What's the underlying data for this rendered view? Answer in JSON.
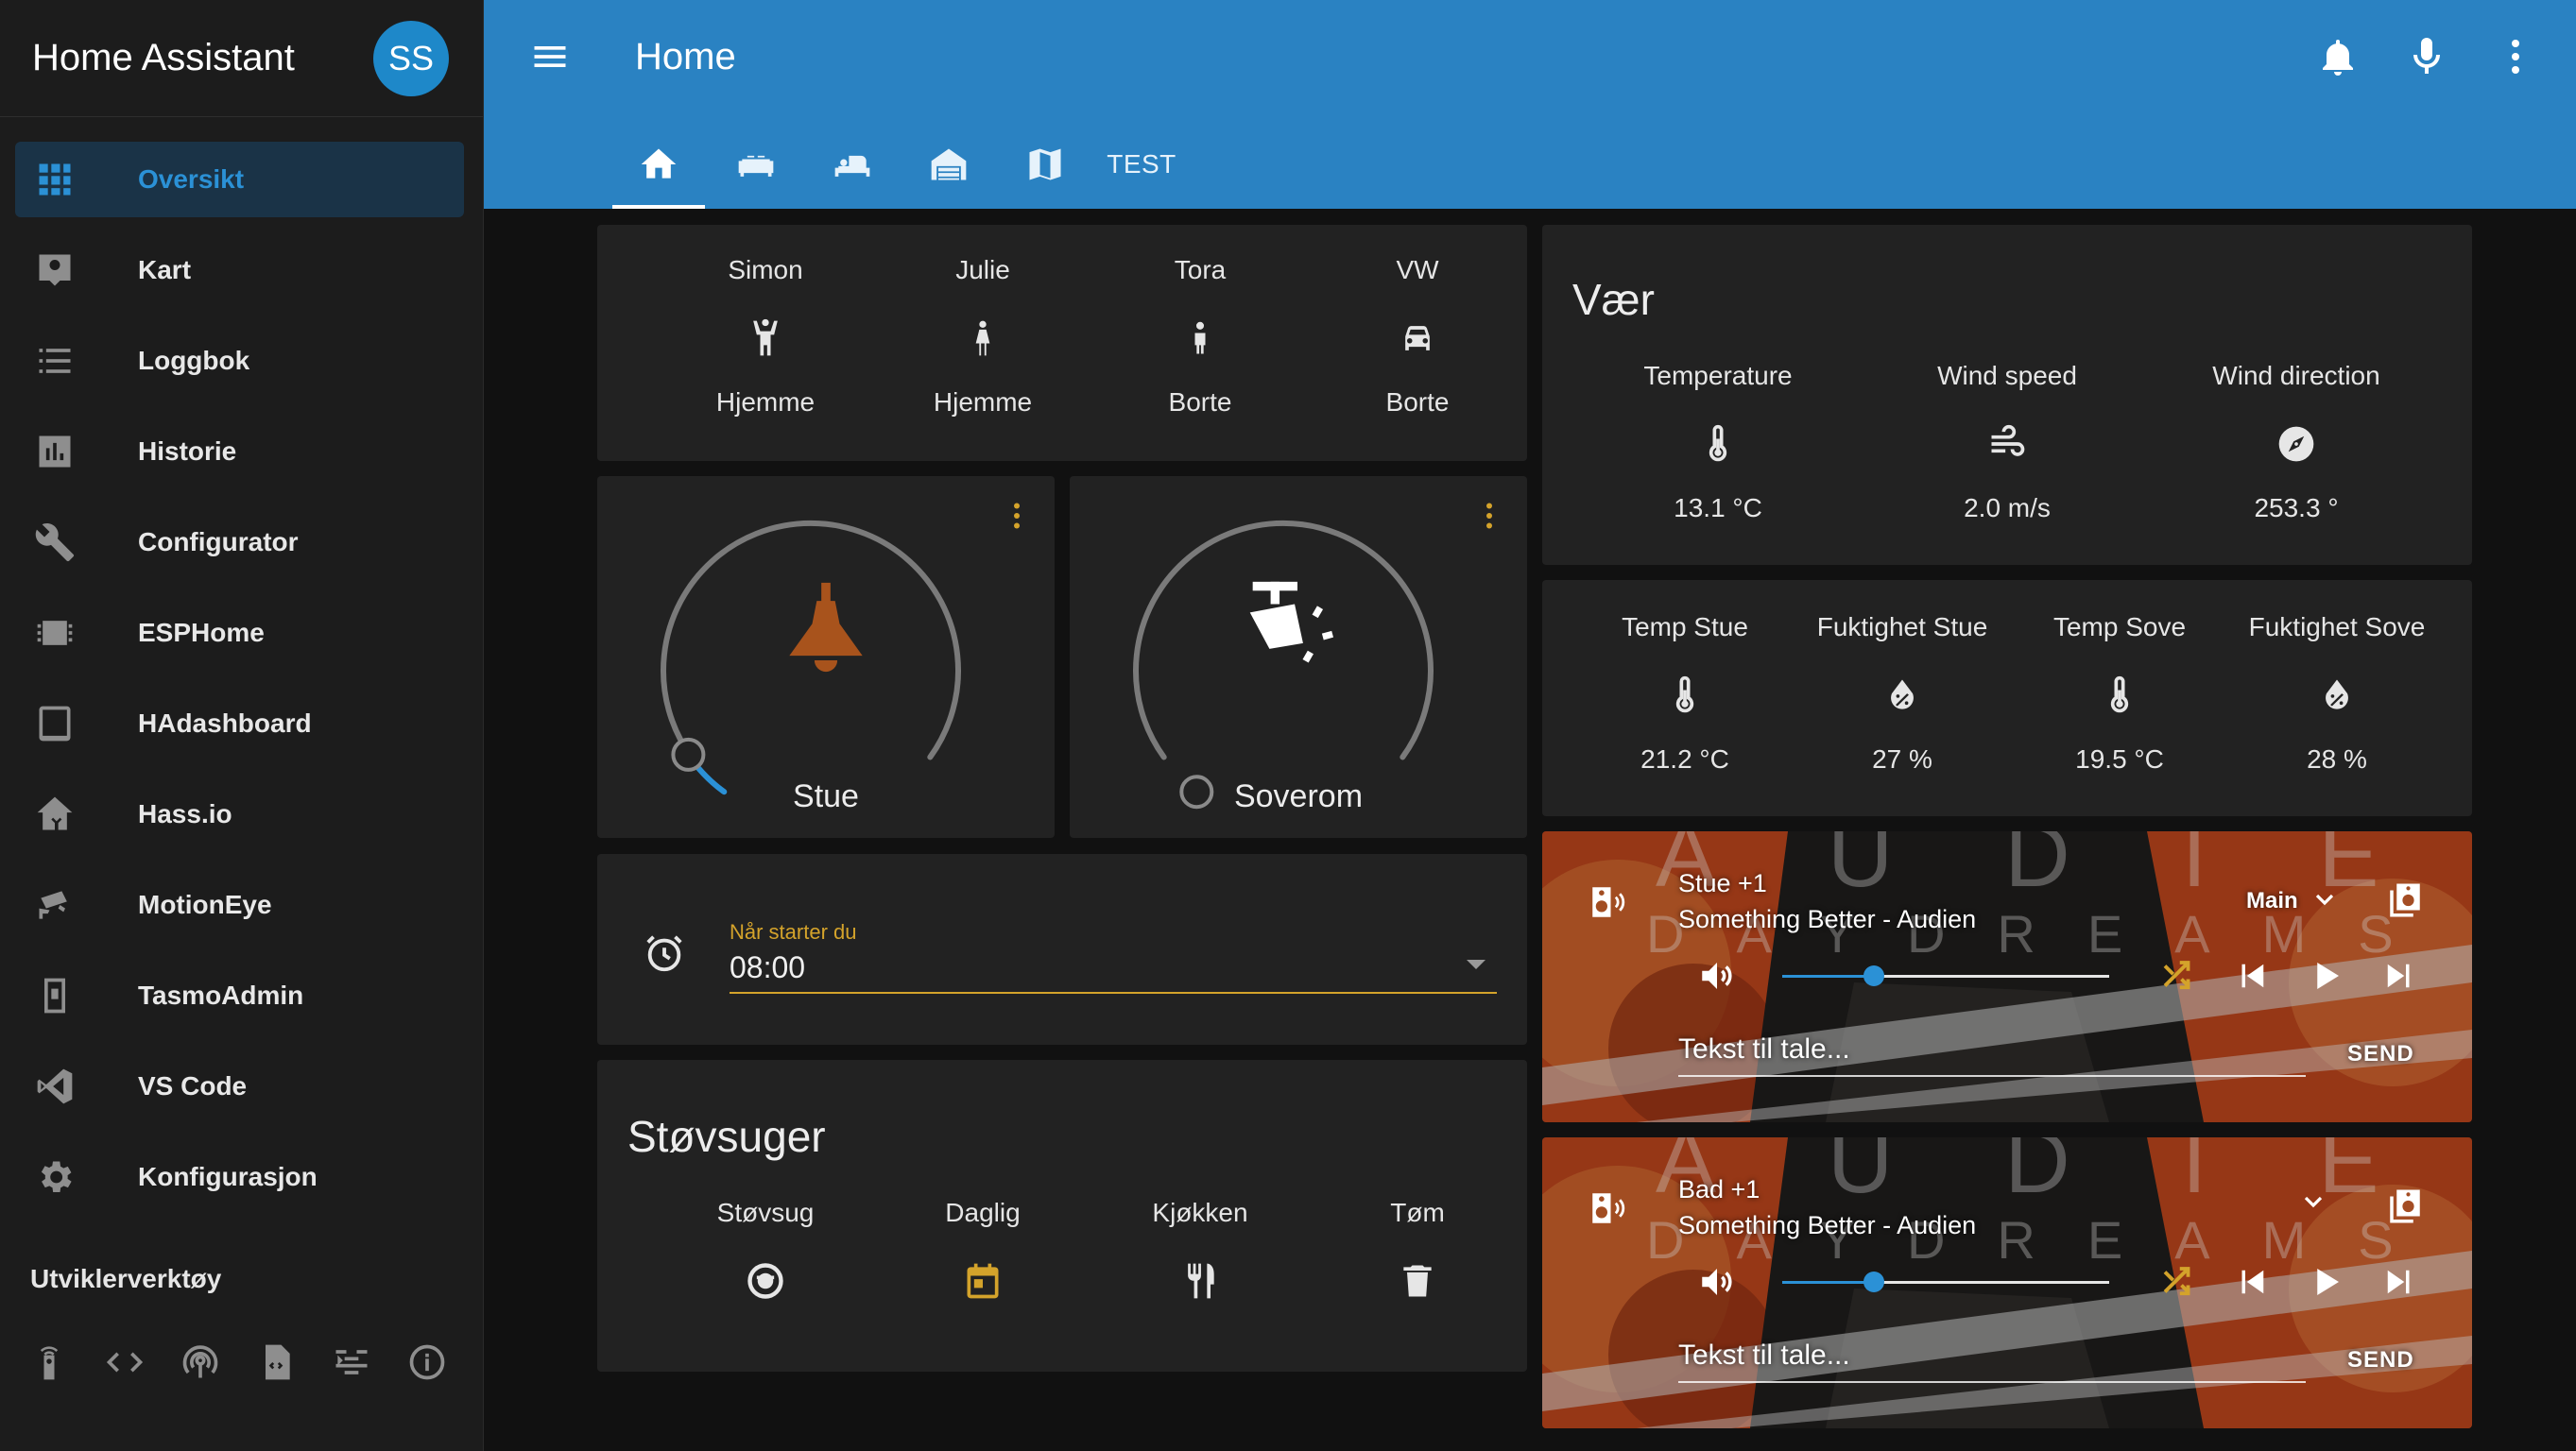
{
  "app": {
    "title": "Home Assistant",
    "avatar_initials": "SS",
    "accent": "#2a82c2",
    "gold": "#d4a32b"
  },
  "sidebar": {
    "items": [
      {
        "label": "Oversikt",
        "icon": "grid-icon",
        "active": true
      },
      {
        "label": "Kart",
        "icon": "account-box-icon"
      },
      {
        "label": "Loggbok",
        "icon": "list-icon"
      },
      {
        "label": "Historie",
        "icon": "chart-icon"
      },
      {
        "label": "Configurator",
        "icon": "wrench-icon"
      },
      {
        "label": "ESPHome",
        "icon": "chip-icon"
      },
      {
        "label": "HAdashboard",
        "icon": "tablet-icon"
      },
      {
        "label": "Hass.io",
        "icon": "home-assistant-icon"
      },
      {
        "label": "MotionEye",
        "icon": "cctv-icon"
      },
      {
        "label": "TasmoAdmin",
        "icon": "device-icon"
      },
      {
        "label": "VS Code",
        "icon": "vscode-icon"
      },
      {
        "label": "Konfigurasjon",
        "icon": "gear-icon"
      }
    ],
    "developer_title": "Utviklerverktøy",
    "developer_tools": [
      "remote-icon",
      "code-icon",
      "broadcast-icon",
      "file-code-icon",
      "template-icon",
      "info-icon"
    ]
  },
  "header": {
    "title": "Home",
    "tabs": [
      {
        "icon": "home-icon",
        "active": true
      },
      {
        "icon": "sofa-icon"
      },
      {
        "icon": "bed-icon"
      },
      {
        "icon": "garage-icon"
      },
      {
        "icon": "map-icon"
      },
      {
        "label": "TEST"
      }
    ],
    "actions": [
      "bell-icon",
      "microphone-icon",
      "more-vertical-icon"
    ]
  },
  "people": [
    {
      "name": "Simon",
      "state": "Hjemme",
      "icon": "person-arms-up-icon"
    },
    {
      "name": "Julie",
      "state": "Hjemme",
      "icon": "woman-icon"
    },
    {
      "name": "Tora",
      "state": "Borte",
      "icon": "child-icon"
    },
    {
      "name": "VW",
      "state": "Borte",
      "icon": "car-icon"
    }
  ],
  "thermostats": [
    {
      "name": "Stue",
      "icon": "lamp-icon",
      "level": 0.07
    },
    {
      "name": "Soverom",
      "icon": "shower-icon",
      "level": 0.0
    }
  ],
  "alarm": {
    "label": "Når starter du",
    "value": "08:00"
  },
  "vacuum": {
    "title": "Støvsuger",
    "items": [
      {
        "name": "Støvsug",
        "icon": "robot-vacuum-icon",
        "color": "#e6e6e6"
      },
      {
        "name": "Daglig",
        "icon": "calendar-icon",
        "color": "#d4a32b"
      },
      {
        "name": "Kjøkken",
        "icon": "silverware-icon",
        "color": "#e6e6e6"
      },
      {
        "name": "Tøm",
        "icon": "trash-icon",
        "color": "#e6e6e6"
      }
    ]
  },
  "weather": {
    "title": "Vær",
    "items": [
      {
        "name": "Temperature",
        "value": "13.1 °C",
        "icon": "thermometer-icon"
      },
      {
        "name": "Wind speed",
        "value": "2.0 m/s",
        "icon": "wind-icon"
      },
      {
        "name": "Wind direction",
        "value": "253.3 °",
        "icon": "compass-icon"
      }
    ]
  },
  "climate": [
    {
      "name": "Temp Stue",
      "value": "21.2 °C",
      "icon": "thermometer-icon"
    },
    {
      "name": "Fuktighet Stue",
      "value": "27 %",
      "icon": "water-percent-icon"
    },
    {
      "name": "Temp Sove",
      "value": "19.5 °C",
      "icon": "thermometer-icon"
    },
    {
      "name": "Fuktighet Sove",
      "value": "28 %",
      "icon": "water-percent-icon"
    }
  ],
  "media_players": [
    {
      "room": "Stue +1",
      "track": "Something Better - Audien",
      "source": "Main",
      "tts_placeholder": "Tekst til tale...",
      "send": "SEND",
      "volume": 0.28
    },
    {
      "room": "Bad +1",
      "track": "Something Better - Audien",
      "source": "",
      "tts_placeholder": "Tekst til tale...",
      "send": "SEND",
      "volume": 0.28
    }
  ],
  "album_art": {
    "line1": "AUDIEN",
    "line2": "DAYDREAMS"
  }
}
